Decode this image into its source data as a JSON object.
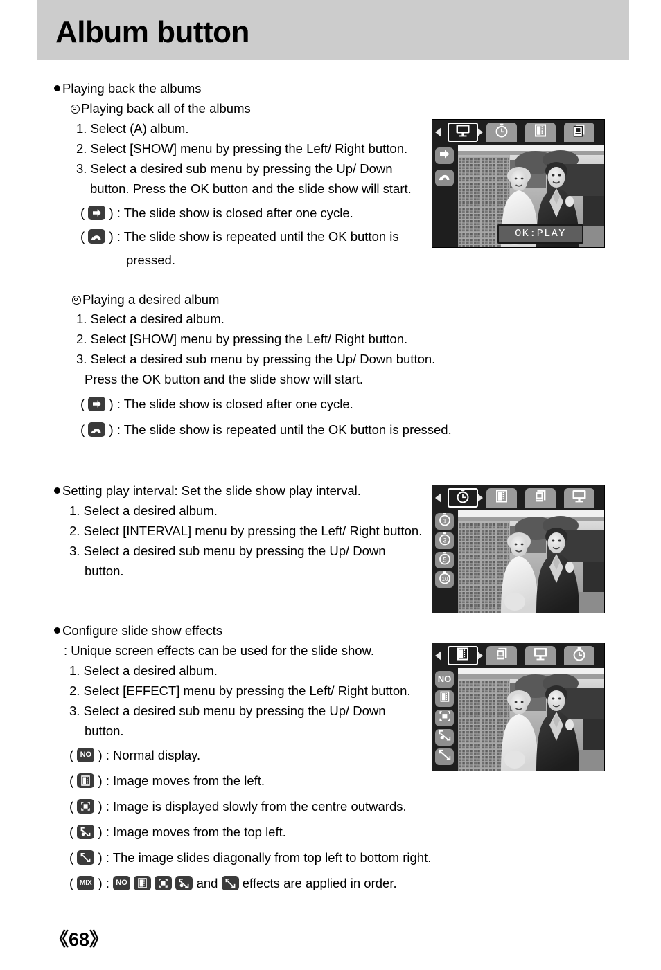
{
  "header": {
    "title": "Album button"
  },
  "sections": [
    {
      "id": "playing-back-albums",
      "heading": "Playing back the albums",
      "sub_heading": "Playing back all of the albums",
      "steps": [
        "1. Select (A) album.",
        "2. Select [SHOW] menu by pressing the Left/ Right button.",
        "3. Select a desired sub menu by pressing the Up/ Down",
        "button. Press the OK button and the slide show will start."
      ],
      "icon_notes": [
        {
          "icon": "arrow-right-icon",
          "text_a": ") : The slide show is closed after one cycle."
        },
        {
          "icon": "repeat-loop-icon",
          "text_a": ") : The slide show is repeated until the OK button is",
          "text_b": "pressed."
        }
      ]
    },
    {
      "id": "playing-desired-album",
      "sub_heading": "Playing a desired album",
      "steps": [
        "1. Select a desired album.",
        "2. Select [SHOW] menu by pressing the Left/ Right button.",
        "3. Select a desired sub menu by pressing the Up/ Down button.",
        "Press the OK button and the slide show will start."
      ],
      "icon_notes": [
        {
          "icon": "arrow-right-icon",
          "text_a": ") : The slide show is closed after one cycle."
        },
        {
          "icon": "repeat-loop-icon",
          "text_a": ") : The slide show is repeated until the OK button is pressed."
        }
      ]
    },
    {
      "id": "setting-play-interval",
      "heading": "Setting play interval: Set the slide show play interval.",
      "steps": [
        "1. Select a desired album.",
        "2. Select [INTERVAL] menu by pressing the Left/ Right button.",
        "3. Select a desired sub menu by pressing the Up/ Down",
        "button."
      ]
    },
    {
      "id": "configure-slide-show-effects",
      "heading": "Configure slide show effects",
      "colon_line": ": Unique screen effects can be used for the slide show.",
      "steps": [
        "1. Select a desired album.",
        "2. Select [EFFECT] menu by pressing the Left/ Right button.",
        "3. Select a desired sub menu by pressing the Up/ Down",
        "button."
      ],
      "effect_notes": [
        {
          "icon": "no-effect-icon",
          "text": ") : Normal display."
        },
        {
          "icon": "slide-from-left-icon",
          "text": ") : Image moves from the left."
        },
        {
          "icon": "centre-outwards-icon",
          "text": ") : Image is displayed slowly from the centre outwards."
        },
        {
          "icon": "move-top-left-icon",
          "text": ") : Image moves from the top left."
        },
        {
          "icon": "diagonal-slide-icon",
          "text": ") : The image slides diagonally from top left to bottom right."
        }
      ],
      "mix_line": {
        "icon": "mix-icon",
        "prefix": ") : ",
        "and_word": "and",
        "suffix": "effects are applied in order.",
        "sequence_icons": [
          "no-effect-icon",
          "slide-from-left-icon",
          "centre-outwards-icon",
          "move-top-left-icon"
        ],
        "last_icon": "diagonal-slide-icon"
      }
    }
  ],
  "chip_labels": {
    "no": "NO",
    "mix": "MIX"
  },
  "lcd_screens": [
    {
      "id": "lcd-show-menu",
      "tabs": [
        {
          "icon": "slideshow-monitor-icon",
          "selected": true
        },
        {
          "icon": "interval-stopwatch-icon",
          "selected": false
        },
        {
          "icon": "effect-filmstrip-icon",
          "selected": false
        },
        {
          "icon": "album-photos-icon",
          "selected": false
        }
      ],
      "side_items": [
        {
          "icon": "arrow-right-icon"
        },
        {
          "icon": "repeat-loop-icon"
        }
      ],
      "overlay_label": "OK:PLAY"
    },
    {
      "id": "lcd-interval-menu",
      "tabs": [
        {
          "icon": "interval-stopwatch-icon",
          "selected": true
        },
        {
          "icon": "effect-filmstrip-icon",
          "selected": false
        },
        {
          "icon": "album-photos-icon",
          "selected": false
        },
        {
          "icon": "slideshow-monitor-icon",
          "selected": false
        }
      ],
      "side_items": [
        {
          "icon": "stopwatch-1-icon",
          "label": "1"
        },
        {
          "icon": "stopwatch-3-icon",
          "label": "3"
        },
        {
          "icon": "stopwatch-5-icon",
          "label": "5"
        },
        {
          "icon": "stopwatch-10-icon",
          "label": "10"
        }
      ]
    },
    {
      "id": "lcd-effect-menu",
      "tabs": [
        {
          "icon": "effect-filmstrip-icon",
          "selected": true
        },
        {
          "icon": "album-photos-icon",
          "selected": false
        },
        {
          "icon": "slideshow-monitor-icon",
          "selected": false
        },
        {
          "icon": "interval-stopwatch-icon",
          "selected": false
        }
      ],
      "side_items": [
        {
          "icon": "no-effect-icon",
          "label": "NO"
        },
        {
          "icon": "slide-from-left-icon"
        },
        {
          "icon": "centre-outwards-icon"
        },
        {
          "icon": "move-top-left-icon"
        },
        {
          "icon": "diagonal-slide-icon"
        }
      ]
    }
  ],
  "footer": {
    "page_number": "《68》"
  },
  "colors": {
    "header_band": "#cccccc",
    "chip_dark": "#3b3b3b",
    "lcd_bg": "#1e1e1e",
    "tab_gray": "#9a9a9a",
    "side_icon_gray": "#8e8e8e"
  }
}
